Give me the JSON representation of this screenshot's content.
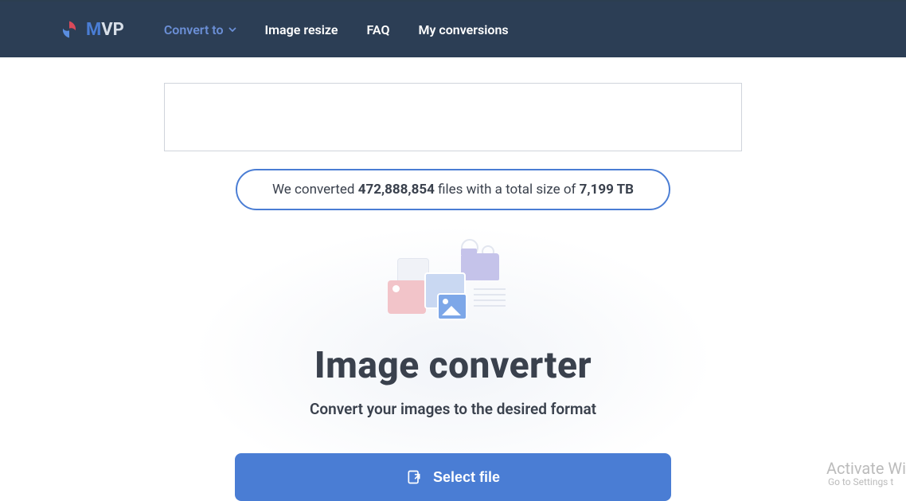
{
  "brand": {
    "letter1": "M",
    "letter2": "VP"
  },
  "nav": {
    "convert": "Convert to",
    "resize": "Image resize",
    "faq": "FAQ",
    "my": "My conversions"
  },
  "stats": {
    "prefix": "We converted ",
    "files": "472,888,854",
    "mid": " files with a total size of ",
    "size": "7,199 TB"
  },
  "hero": {
    "title": "Image converter",
    "subtitle": "Convert your images to the desired format",
    "button": "Select file"
  },
  "watermark": {
    "line1": "Activate Wi",
    "line2": "Go to Settings t"
  }
}
